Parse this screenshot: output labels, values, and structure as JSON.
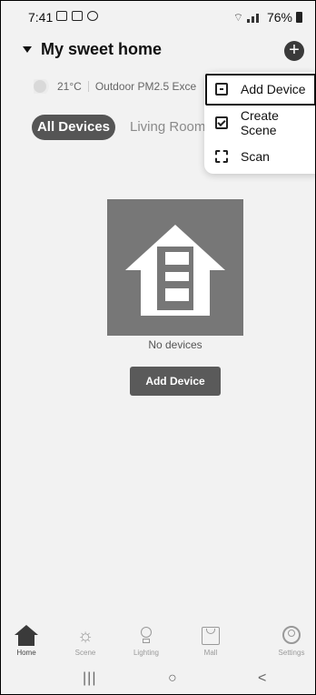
{
  "status_bar": {
    "time": "7:41",
    "battery": "76%"
  },
  "header": {
    "home_name": "My sweet home",
    "add_button": "+"
  },
  "weather": {
    "temperature": "21°C",
    "air_quality": "Outdoor PM2.5 Exce"
  },
  "tabs": [
    {
      "label": "All Devices",
      "active": true
    },
    {
      "label": "Living Room",
      "active": false
    }
  ],
  "menu": {
    "items": [
      {
        "label": "Add Device",
        "icon": "add-device-icon"
      },
      {
        "label": "Create Scene",
        "icon": "create-scene-icon"
      },
      {
        "label": "Scan",
        "icon": "scan-icon"
      }
    ]
  },
  "empty_state": {
    "message": "No devices",
    "button": "Add Device"
  },
  "bottom_nav": {
    "items": [
      {
        "label": "Home",
        "icon": "home-icon",
        "active": true
      },
      {
        "label": "Scene",
        "icon": "sun-icon"
      },
      {
        "label": "Lighting",
        "icon": "bulb-icon"
      },
      {
        "label": "Mall",
        "icon": "bag-icon"
      },
      {
        "label": "Settings",
        "icon": "user-icon"
      }
    ]
  },
  "system_nav": {
    "recent": "|||",
    "home": "○",
    "back": "<"
  }
}
